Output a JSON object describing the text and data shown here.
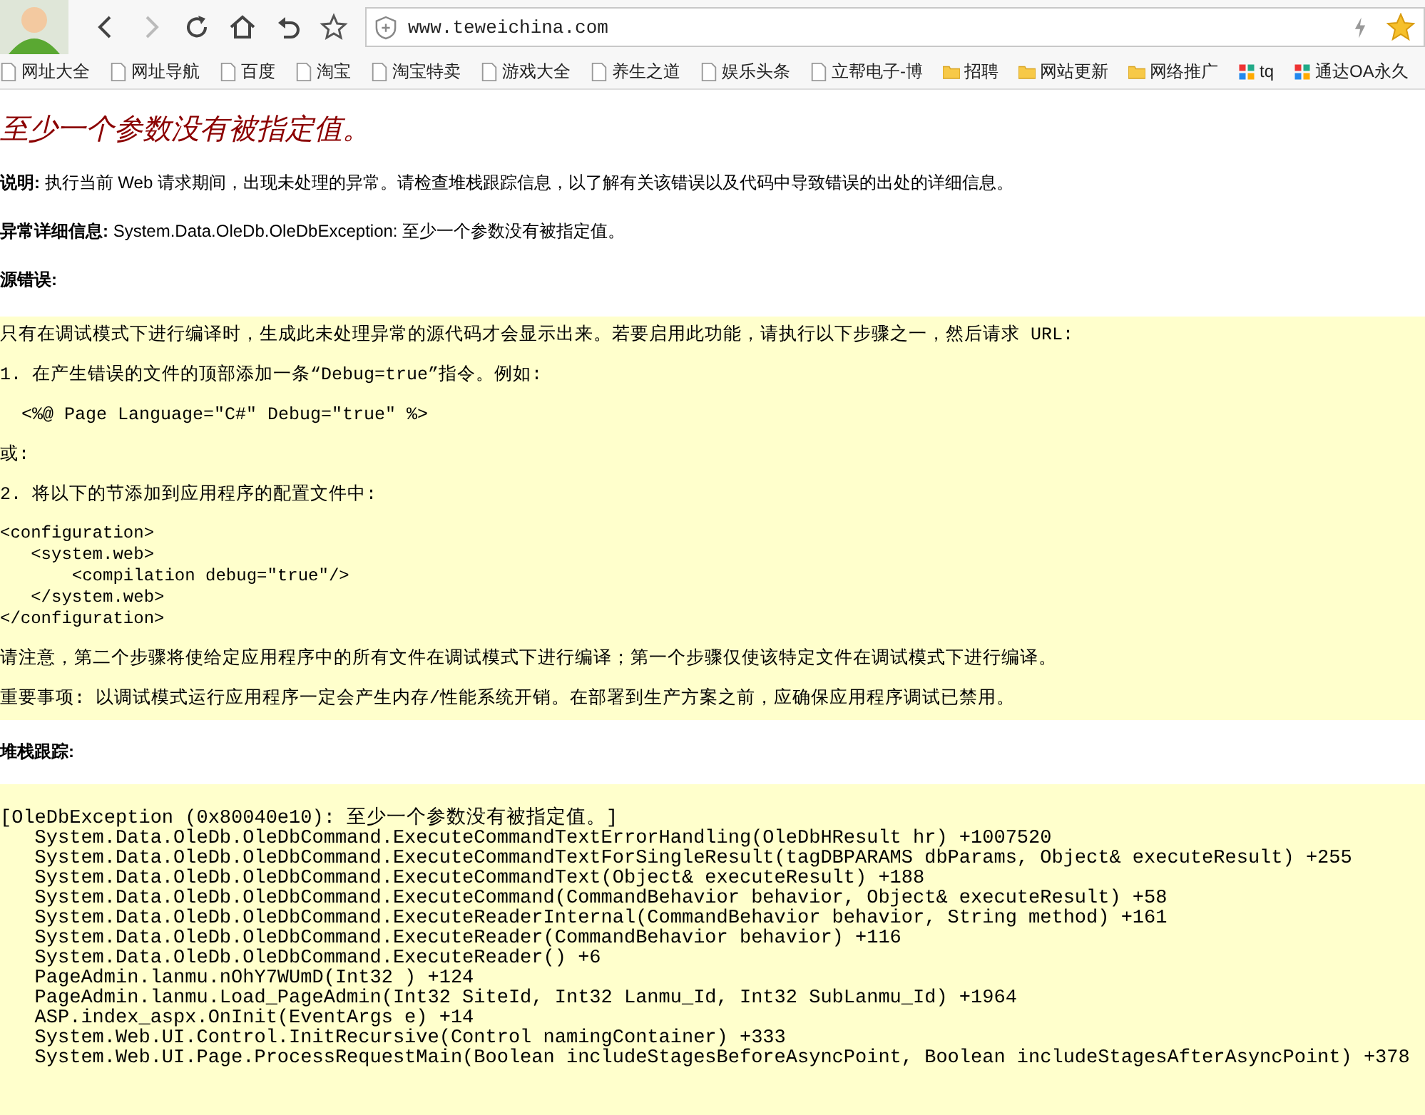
{
  "browser": {
    "url": "www.teweichina.com",
    "bookmarks": [
      {
        "label": "网址大全",
        "kind": "page"
      },
      {
        "label": "网址导航",
        "kind": "page"
      },
      {
        "label": "百度",
        "kind": "page"
      },
      {
        "label": "淘宝",
        "kind": "page"
      },
      {
        "label": "淘宝特卖",
        "kind": "page"
      },
      {
        "label": "游戏大全",
        "kind": "page"
      },
      {
        "label": "养生之道",
        "kind": "page"
      },
      {
        "label": "娱乐头条",
        "kind": "page"
      },
      {
        "label": "立帮电子-博",
        "kind": "page"
      },
      {
        "label": "招聘",
        "kind": "folder"
      },
      {
        "label": "网站更新",
        "kind": "folder"
      },
      {
        "label": "网络推广",
        "kind": "folder"
      },
      {
        "label": "tq",
        "kind": "app"
      },
      {
        "label": "通达OA永久",
        "kind": "app"
      }
    ]
  },
  "page": {
    "title": "至少一个参数没有被指定值。",
    "description": {
      "label": "说明:",
      "text": "执行当前 Web 请求期间，出现未处理的异常。请检查堆栈跟踪信息，以了解有关该错误以及代码中导致错误的出处的详细信息。"
    },
    "exception_details": {
      "label": "异常详细信息:",
      "text": "System.Data.OleDb.OleDbException: 至少一个参数没有被指定值。"
    },
    "source_error": {
      "label": "源错误:",
      "blocks": [
        {
          "kind": "para",
          "text": "只有在调试模式下进行编译时，生成此未处理异常的源代码才会显示出来。若要启用此功能，请执行以下步骤之一，然后请求 URL:"
        },
        {
          "kind": "para",
          "text": "1. 在产生错误的文件的顶部添加一条“Debug=true”指令。例如:"
        },
        {
          "kind": "para",
          "text": "  <%@ Page Language=\"C#\" Debug=\"true\" %>"
        },
        {
          "kind": "para",
          "text": "或:"
        },
        {
          "kind": "para",
          "text": "2. 将以下的节添加到应用程序的配置文件中:"
        },
        {
          "kind": "code",
          "lines": [
            "<configuration>",
            "   <system.web>",
            "       <compilation debug=\"true\"/>",
            "   </system.web>",
            "</configuration>"
          ]
        },
        {
          "kind": "para",
          "text": "请注意，第二个步骤将使给定应用程序中的所有文件在调试模式下进行编译；第一个步骤仅使该特定文件在调试模式下进行编译。"
        },
        {
          "kind": "para",
          "text": "重要事项: 以调试模式运行应用程序一定会产生内存/性能系统开销。在部署到生产方案之前，应确保应用程序调试已禁用。"
        }
      ]
    },
    "stack_trace": {
      "label": "堆栈跟踪:",
      "lines": [
        "[OleDbException (0x80040e10): 至少一个参数没有被指定值。]",
        "   System.Data.OleDb.OleDbCommand.ExecuteCommandTextErrorHandling(OleDbHResult hr) +1007520",
        "   System.Data.OleDb.OleDbCommand.ExecuteCommandTextForSingleResult(tagDBPARAMS dbParams, Object& executeResult) +255",
        "   System.Data.OleDb.OleDbCommand.ExecuteCommandText(Object& executeResult) +188",
        "   System.Data.OleDb.OleDbCommand.ExecuteCommand(CommandBehavior behavior, Object& executeResult) +58",
        "   System.Data.OleDb.OleDbCommand.ExecuteReaderInternal(CommandBehavior behavior, String method) +161",
        "   System.Data.OleDb.OleDbCommand.ExecuteReader(CommandBehavior behavior) +116",
        "   System.Data.OleDb.OleDbCommand.ExecuteReader() +6",
        "   PageAdmin.lanmu.nOhY7WUmD(Int32 ) +124",
        "   PageAdmin.lanmu.Load_PageAdmin(Int32 SiteId, Int32 Lanmu_Id, Int32 SubLanmu_Id) +1964",
        "   ASP.index_aspx.OnInit(EventArgs e) +14",
        "   System.Web.UI.Control.InitRecursive(Control namingContainer) +333",
        "   System.Web.UI.Page.ProcessRequestMain(Boolean includeStagesBeforeAsyncPoint, Boolean includeStagesAfterAsyncPoint) +378"
      ]
    }
  }
}
